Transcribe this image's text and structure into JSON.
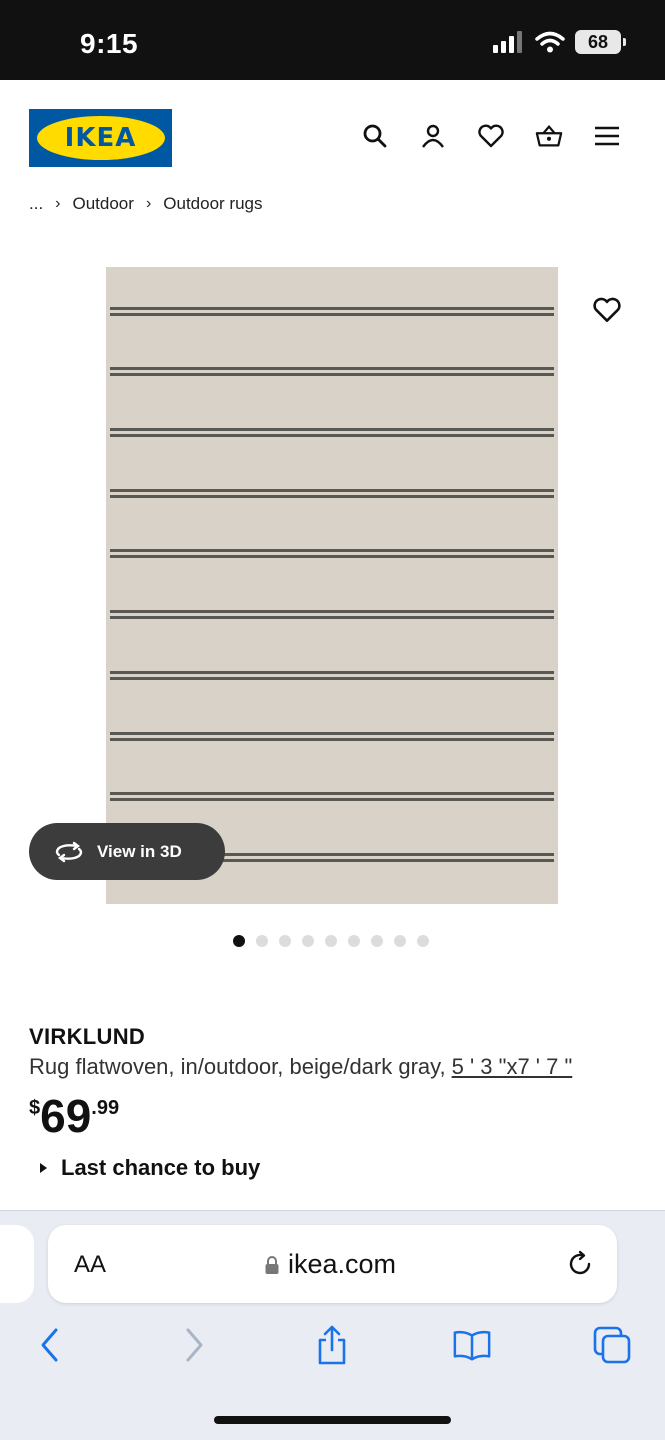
{
  "status": {
    "time": "9:15",
    "battery": "68"
  },
  "header": {
    "logo_text": "IKEA",
    "brand_colors": {
      "blue": "#0058a3",
      "yellow": "#ffdb00"
    },
    "icons": [
      "search-icon",
      "account-icon",
      "heart-icon",
      "cart-icon",
      "menu-icon"
    ]
  },
  "breadcrumb": {
    "ellipsis": "...",
    "items": [
      "Outdoor",
      "Outdoor rugs"
    ]
  },
  "image": {
    "view3d_label": "View in 3D",
    "dot_count": 9,
    "active_dot": 0
  },
  "product": {
    "name": "VIRKLUND",
    "description": "Rug flatwoven, in/outdoor, beige/dark gray,",
    "size": "5 ' 3 \"x7 ' 7 \"",
    "price_currency": "$",
    "price_int": "69",
    "price_dec": ".99",
    "availability": "Last chance to buy"
  },
  "browser": {
    "aa": "AA",
    "url": "ikea.com"
  }
}
